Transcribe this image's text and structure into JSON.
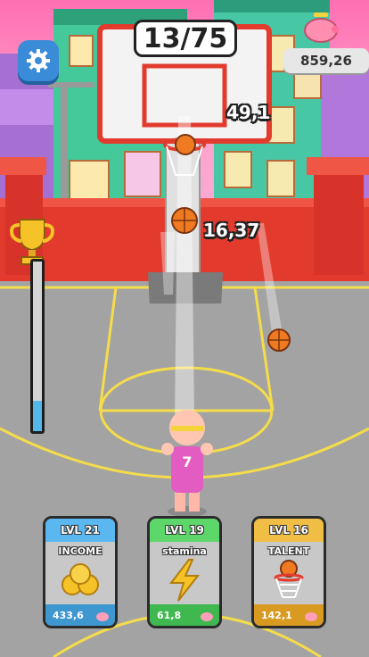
{
  "hud": {
    "shot_counter": "13/75",
    "money": "859,26",
    "settings_icon": "gear-icon",
    "piggy_icon": "piggy-bank-icon",
    "trophy_icon": "trophy-icon",
    "power_meter_fraction": 0.18
  },
  "floating_rewards": [
    {
      "text": "49,1"
    },
    {
      "text": "16,37"
    }
  ],
  "player": {
    "jersey_number": "7"
  },
  "upgrades": [
    {
      "level": "LVL 21",
      "title": "INCOME",
      "cost": "433,6",
      "icon": "coins-icon",
      "accent": "#5ab7f0"
    },
    {
      "level": "LVL 19",
      "title": "stamina",
      "cost": "61,8",
      "icon": "lightning-icon",
      "accent": "#5dd66a"
    },
    {
      "level": "LVL 16",
      "title": "TALENT",
      "cost": "142,1",
      "icon": "basketball-hoop-icon",
      "accent": "#f0bd45"
    }
  ],
  "colors": {
    "wall": "#e23b2e",
    "court": "#a3a3a3",
    "court_lines": "#f5dc4a",
    "money_box": "#e7e7e7",
    "settings_button": "#3a8bd8"
  }
}
